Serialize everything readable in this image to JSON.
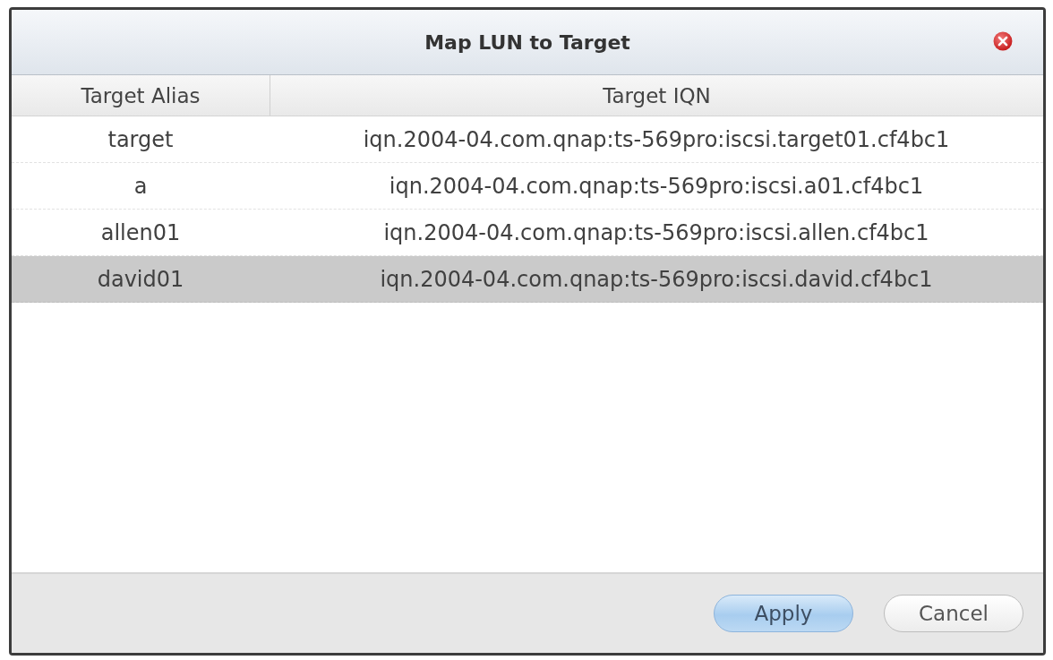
{
  "window": {
    "title": "Map LUN to Target"
  },
  "table": {
    "columns": [
      "Target Alias",
      "Target IQN"
    ],
    "rows": [
      {
        "alias": "target",
        "iqn": "iqn.2004-04.com.qnap:ts-569pro:iscsi.target01.cf4bc1",
        "selected": false
      },
      {
        "alias": "a",
        "iqn": "iqn.2004-04.com.qnap:ts-569pro:iscsi.a01.cf4bc1",
        "selected": false
      },
      {
        "alias": "allen01",
        "iqn": "iqn.2004-04.com.qnap:ts-569pro:iscsi.allen.cf4bc1",
        "selected": false
      },
      {
        "alias": "david01",
        "iqn": "iqn.2004-04.com.qnap:ts-569pro:iscsi.david.cf4bc1",
        "selected": true
      }
    ]
  },
  "buttons": [
    {
      "label": "Apply",
      "kind": "primary"
    },
    {
      "label": "Cancel",
      "kind": "secondary"
    }
  ]
}
